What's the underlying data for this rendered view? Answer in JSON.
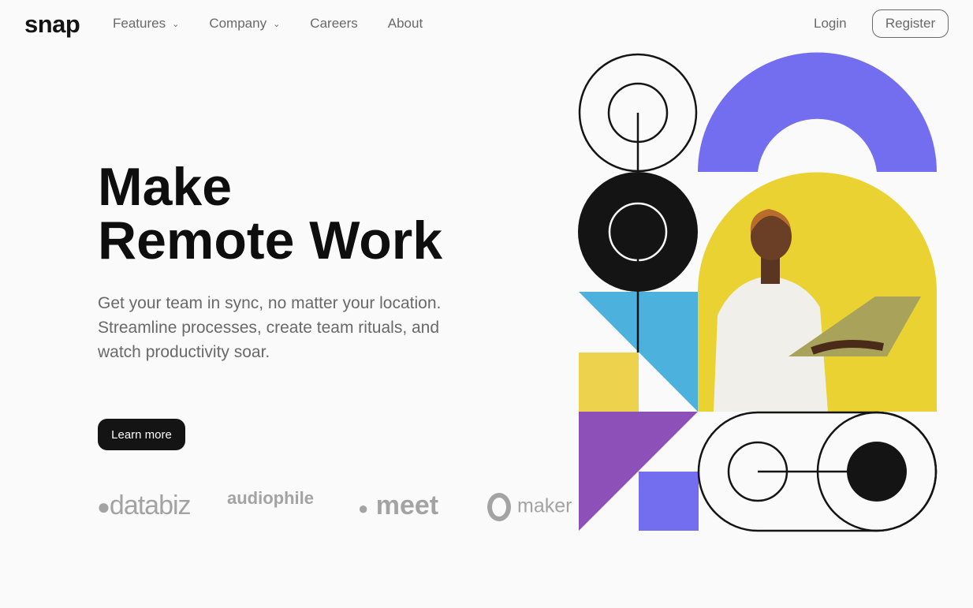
{
  "brand": {
    "logo": "snap"
  },
  "nav": {
    "items": [
      {
        "label": "Features",
        "dropdown": true
      },
      {
        "label": "Company",
        "dropdown": true
      },
      {
        "label": "Careers"
      },
      {
        "label": "About"
      }
    ]
  },
  "auth": {
    "login": "Login",
    "register": "Register"
  },
  "hero": {
    "title_line1": "Make",
    "title_line2": "Remote Work",
    "subtitle": "Get your team in sync, no matter your location. Streamline processes, create team rituals, and watch productivity soar.",
    "cta": "Learn more"
  },
  "clients": [
    "databiz",
    "audiophile",
    "meet",
    "maker"
  ],
  "colors": {
    "blue": "#4cb1dc",
    "yellow": "#edd24d",
    "purple": "#8d4fb8",
    "violet": "#736df0",
    "dark": "#141414"
  }
}
